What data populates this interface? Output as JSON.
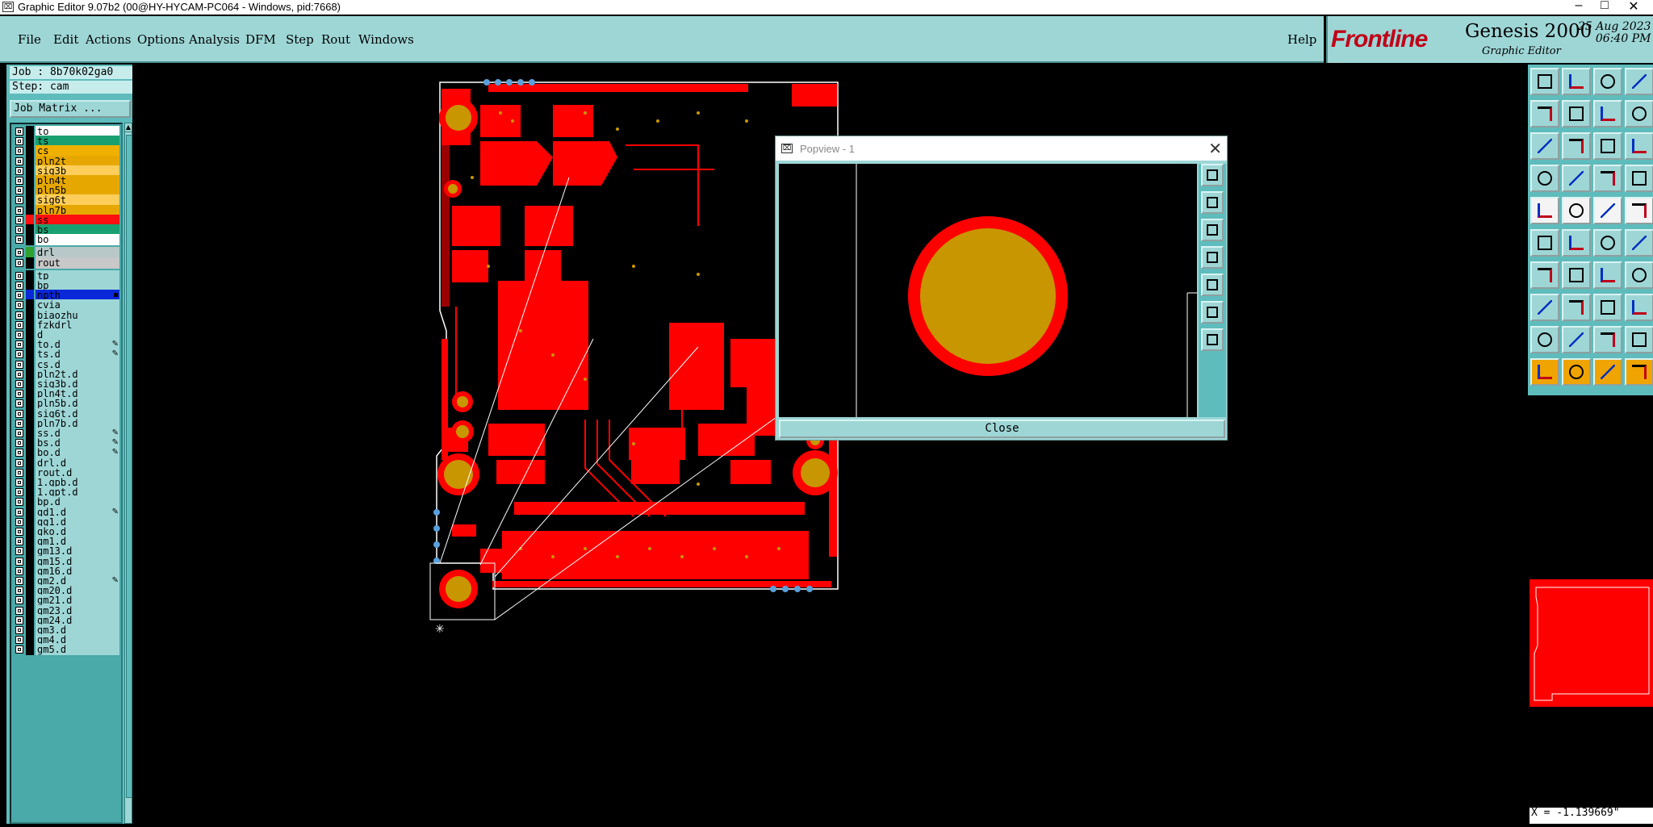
{
  "window": {
    "title": "Graphic Editor 9.07b2 (00@HY-HYCAM-PC064 - Windows, pid:7668)",
    "minimize": "–",
    "maximize": "□",
    "close": "✕"
  },
  "menubar": {
    "items": [
      "File",
      "Edit",
      "Actions",
      "Options",
      "Analysis",
      "DFM",
      "Step",
      "Rout",
      "Windows"
    ],
    "help": "Help"
  },
  "brand": {
    "logo": "Frontline",
    "product": "Genesis 2000",
    "subtitle": "Graphic Editor",
    "date": "25 Aug 2023",
    "time": "06:40 PM"
  },
  "job": {
    "label": "Job : 8b70k02ga0",
    "step": "Step: cam",
    "matrix_button": "Job Matrix ..."
  },
  "layers": [
    {
      "name": "to",
      "color": "#ffffff",
      "mark": ""
    },
    {
      "name": "ts",
      "color": "#1aa070",
      "mark": ""
    },
    {
      "name": "cs",
      "color": "#f0b000",
      "mark": ""
    },
    {
      "name": "pln2t",
      "color": "#e6a800",
      "mark": ""
    },
    {
      "name": "sig3b",
      "color": "#ffce5a",
      "mark": ""
    },
    {
      "name": "pln4t",
      "color": "#e6a800",
      "mark": ""
    },
    {
      "name": "pln5b",
      "color": "#e6a800",
      "mark": ""
    },
    {
      "name": "sig6t",
      "color": "#ffce5a",
      "mark": ""
    },
    {
      "name": "pln7b",
      "color": "#e6a800",
      "mark": ""
    },
    {
      "name": "ss",
      "color": "#ff1010",
      "mark": ""
    },
    {
      "name": "bs",
      "color": "#1aa070",
      "mark": ""
    },
    {
      "name": "bo",
      "color": "#ffffff",
      "mark": ""
    },
    {
      "name": "drl",
      "color": "#b8c8c8",
      "mark": ""
    },
    {
      "name": "rout",
      "color": "#c8c8c8",
      "mark": ""
    },
    {
      "name": "tp",
      "color": "#9ed6d6",
      "mark": ""
    },
    {
      "name": "bp",
      "color": "#9ed6d6",
      "mark": ""
    },
    {
      "name": "npth",
      "color": "#0a28d8",
      "mark": "▪"
    },
    {
      "name": "cvia",
      "color": "#9ed6d6",
      "mark": ""
    },
    {
      "name": "biaozhu",
      "color": "#9ed6d6",
      "mark": ""
    },
    {
      "name": "fzkdrl",
      "color": "#9ed6d6",
      "mark": ""
    },
    {
      "name": "d",
      "color": "#9ed6d6",
      "mark": ""
    },
    {
      "name": "to.d",
      "color": "#9ed6d6",
      "mark": "✎"
    },
    {
      "name": "ts.d",
      "color": "#9ed6d6",
      "mark": "✎"
    },
    {
      "name": "cs.d",
      "color": "#9ed6d6",
      "mark": ""
    },
    {
      "name": "pln2t.d",
      "color": "#9ed6d6",
      "mark": ""
    },
    {
      "name": "sig3b.d",
      "color": "#9ed6d6",
      "mark": ""
    },
    {
      "name": "pln4t.d",
      "color": "#9ed6d6",
      "mark": ""
    },
    {
      "name": "pln5b.d",
      "color": "#9ed6d6",
      "mark": ""
    },
    {
      "name": "sig6t.d",
      "color": "#9ed6d6",
      "mark": ""
    },
    {
      "name": "pln7b.d",
      "color": "#9ed6d6",
      "mark": ""
    },
    {
      "name": "ss.d",
      "color": "#9ed6d6",
      "mark": "✎"
    },
    {
      "name": "bs.d",
      "color": "#9ed6d6",
      "mark": "✎"
    },
    {
      "name": "bo.d",
      "color": "#9ed6d6",
      "mark": "✎"
    },
    {
      "name": "drl.d",
      "color": "#9ed6d6",
      "mark": ""
    },
    {
      "name": "rout.d",
      "color": "#9ed6d6",
      "mark": ""
    },
    {
      "name": "1.gpb.d",
      "color": "#9ed6d6",
      "mark": ""
    },
    {
      "name": "1.gpt.d",
      "color": "#9ed6d6",
      "mark": ""
    },
    {
      "name": "bp.d",
      "color": "#9ed6d6",
      "mark": ""
    },
    {
      "name": "gd1.d",
      "color": "#9ed6d6",
      "mark": "✎"
    },
    {
      "name": "gg1.d",
      "color": "#9ed6d6",
      "mark": ""
    },
    {
      "name": "gko.d",
      "color": "#9ed6d6",
      "mark": ""
    },
    {
      "name": "gm1.d",
      "color": "#9ed6d6",
      "mark": ""
    },
    {
      "name": "gm13.d",
      "color": "#9ed6d6",
      "mark": ""
    },
    {
      "name": "gm15.d",
      "color": "#9ed6d6",
      "mark": ""
    },
    {
      "name": "gm16.d",
      "color": "#9ed6d6",
      "mark": ""
    },
    {
      "name": "gm2.d",
      "color": "#9ed6d6",
      "mark": "✎"
    },
    {
      "name": "gm20.d",
      "color": "#9ed6d6",
      "mark": ""
    },
    {
      "name": "gm21.d",
      "color": "#9ed6d6",
      "mark": ""
    },
    {
      "name": "gm23.d",
      "color": "#9ed6d6",
      "mark": ""
    },
    {
      "name": "gm24.d",
      "color": "#9ed6d6",
      "mark": ""
    },
    {
      "name": "gm3.d",
      "color": "#9ed6d6",
      "mark": ""
    },
    {
      "name": "gm4.d",
      "color": "#9ed6d6",
      "mark": ""
    },
    {
      "name": "gm5.d",
      "color": "#9ed6d6",
      "mark": ""
    }
  ],
  "popview": {
    "title": "Popview - 1",
    "close_label": "Close"
  },
  "status": {
    "coord": "X = -1.139669\""
  },
  "colors": {
    "panel": "#9ed6d6",
    "copper": "#ff0000",
    "pad": "#c89600"
  }
}
